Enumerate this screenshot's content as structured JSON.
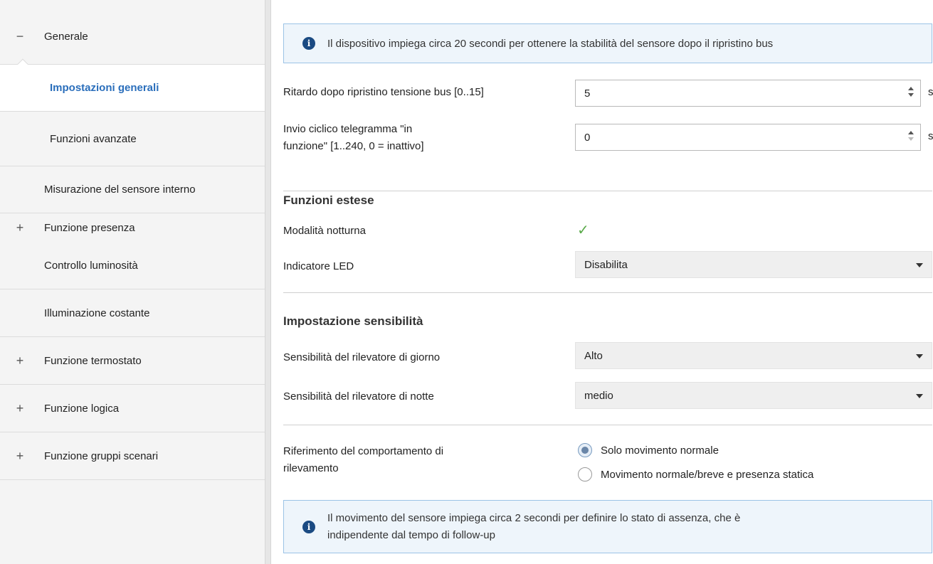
{
  "sidebar": {
    "items": [
      {
        "sign": "−",
        "label": "Generale"
      },
      {
        "sign": "",
        "label": "Impostazioni generali"
      },
      {
        "sign": "",
        "label": "Funzioni avanzate"
      },
      {
        "sign": "",
        "label": "Misurazione del sensore interno"
      },
      {
        "sign": "+",
        "label": "Funzione presenza"
      },
      {
        "sign": "",
        "label": "Controllo luminosità"
      },
      {
        "sign": "",
        "label": "Illuminazione costante"
      },
      {
        "sign": "+",
        "label": "Funzione termostato"
      },
      {
        "sign": "+",
        "label": "Funzione logica"
      },
      {
        "sign": "+",
        "label": "Funzione gruppi scenari"
      }
    ]
  },
  "main": {
    "info_top": "Il dispositivo impiega circa 20 secondi per ottenere la stabilità del sensore dopo il ripristino bus",
    "info_icon": "i",
    "delay": {
      "label": "Ritardo dopo ripristino tensione bus [0..15]",
      "value": "5",
      "unit": "s"
    },
    "cyclic": {
      "label_line1": "Invio ciclico telegramma \"in",
      "label_line2": "funzione\" [1..240, 0 = inattivo]",
      "value": "0",
      "unit": "s"
    },
    "extended": {
      "title": "Funzioni estese",
      "night_mode_label": "Modalità notturna",
      "night_mode_checked": true,
      "check_glyph": "✓",
      "led_label": "Indicatore LED",
      "led_value": "Disabilita"
    },
    "sensitivity": {
      "title": "Impostazione sensibilità",
      "day_label": "Sensibilità del rilevatore di giorno",
      "day_value": "Alto",
      "night_label": "Sensibilità del rilevatore di notte",
      "night_value": "medio"
    },
    "detection": {
      "label_line1": "Riferimento del comportamento di",
      "label_line2": "rilevamento",
      "options": [
        "Solo movimento normale",
        "Movimento normale/breve e presenza statica"
      ],
      "selected_index": 0
    },
    "info_bottom_line1": "Il movimento del sensore impiega circa 2 secondi per definire lo stato di assenza, che è",
    "info_bottom_line2": "indipendente dal tempo di follow-up"
  },
  "colors": {
    "accent": "#2a6ebb",
    "info_bg": "#eef5fb",
    "info_border": "#9cc3e6",
    "check": "#5aaa4a"
  }
}
